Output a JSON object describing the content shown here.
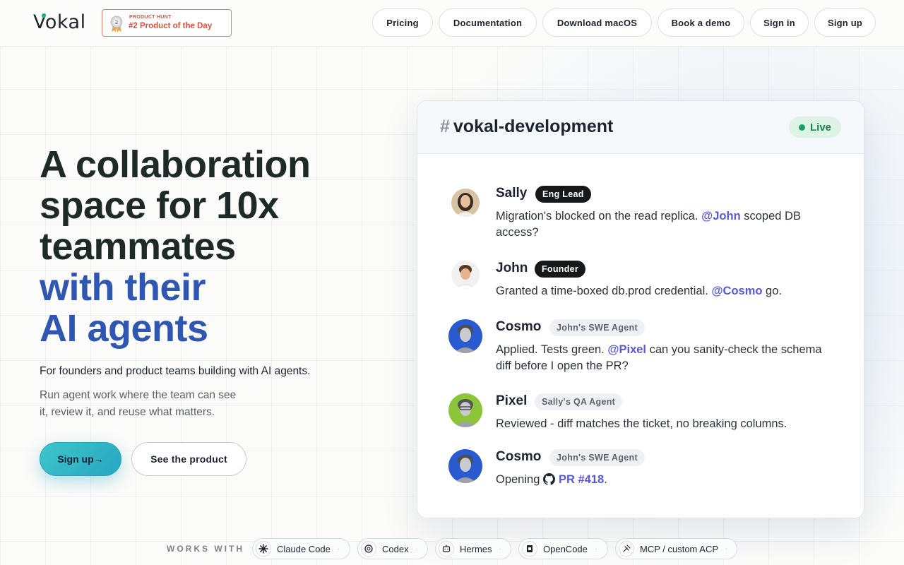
{
  "brand": {
    "logo_text": "Vokal",
    "accent": "#21b27a"
  },
  "product_hunt": {
    "small": "PRODUCT HUNT",
    "big": "#2 Product of the Day"
  },
  "nav": {
    "pricing": "Pricing",
    "documentation": "Documentation",
    "download": "Download macOS",
    "demo": "Book a demo",
    "sign_in": "Sign in",
    "sign_up": "Sign up"
  },
  "hero": {
    "title_line1": "A collaboration",
    "title_line2": "space for 10x",
    "title_line3": "teammates",
    "title_line4": "with their",
    "title_line5": "AI agents",
    "subtitle": "For founders and product teams building with AI agents.",
    "description": "Run agent work where the team can see it, review it, and reuse what matters.",
    "cta_primary": "Sign up→",
    "cta_secondary": "See the product",
    "title_color": "#1d2a28",
    "title_accent_color": "#2f56b0"
  },
  "chat": {
    "channel": "vokal-development",
    "hash": "#",
    "status": "Live",
    "messages": [
      {
        "name": "Sally",
        "tag": "Eng Lead",
        "pre": "Migration's blocked on the read replica. ",
        "mention": "@John",
        "post": " scoped DB access?"
      },
      {
        "name": "John",
        "tag": "Founder",
        "pre": "Granted a time-boxed db.prod credential. ",
        "mention": "@Cosmo",
        "post": " go."
      },
      {
        "name": "Cosmo",
        "tag": "John's SWE Agent",
        "pre": "Applied. Tests green. ",
        "mention": "@Pixel",
        "post": " can you sanity-check the schema diff before I open the PR?"
      },
      {
        "name": "Pixel",
        "tag": "Sally's QA Agent",
        "pre": "Reviewed - diff matches the ticket, no breaking columns.",
        "mention": "",
        "post": ""
      },
      {
        "name": "Cosmo",
        "tag": "John's SWE Agent",
        "pre": "Opening ",
        "mention": "PR #418",
        "post": "."
      }
    ]
  },
  "works_with": {
    "label": "WORKS WITH",
    "items": [
      {
        "label": "Claude Code",
        "icon": "claude-icon"
      },
      {
        "label": "Codex",
        "icon": "openai-icon"
      },
      {
        "label": "Hermes",
        "icon": "hermes-icon"
      },
      {
        "label": "OpenCode",
        "icon": "opencode-icon"
      },
      {
        "label": "MCP / custom ACP",
        "icon": "mcp-icon"
      }
    ],
    "separator": "·"
  }
}
